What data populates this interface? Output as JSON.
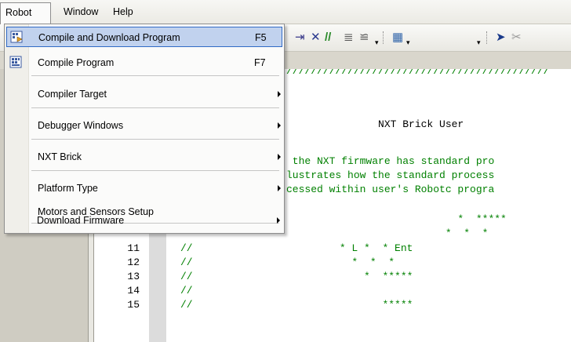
{
  "menubar": {
    "items": [
      "Robot",
      "Window",
      "Help"
    ]
  },
  "robot_menu": {
    "items": [
      {
        "label": "Compile and Download Program",
        "shortcut": "F5",
        "icon": "download-program-icon",
        "highlighted": true
      },
      {
        "label": "Compile Program",
        "shortcut": "F7",
        "icon": "compile-program-icon"
      },
      {
        "label": "Compiler Target",
        "submenu": true
      },
      {
        "label": "Debugger Windows",
        "submenu": true
      },
      {
        "label": "NXT Brick",
        "submenu": true
      },
      {
        "label": "Platform Type",
        "submenu": true
      },
      {
        "label": "Motors and Sensors Setup"
      },
      {
        "label": "Download Firmware",
        "submenu": true
      }
    ]
  },
  "editor": {
    "visible_lines": [
      {
        "num": "",
        "text": "///////////////////////////////////////////",
        "color": "#008000"
      },
      {
        "num": "",
        "text": "",
        "color": "#008000"
      },
      {
        "num": "",
        "text": "               NXT Brick User",
        "color": "#000000"
      },
      {
        "num": "",
        "text": "",
        "color": "#008000"
      },
      {
        "num": "",
        "text": " the NXT firmware has standard pro",
        "color": "#008000"
      },
      {
        "num": "",
        "text": "lustrates how the standard process",
        "color": "#008000"
      },
      {
        "num": "",
        "text": "cessed within user's Robotc progra",
        "color": "#008000"
      },
      {
        "num": "",
        "text": "",
        "color": "#008000"
      },
      {
        "num": "",
        "text": "                            *  *****",
        "color": "#008000"
      },
      {
        "num": "",
        "text": "                          *  *  *",
        "color": "#008000"
      },
      {
        "num": "11",
        "text": "//                        * L *  * Ent",
        "color": "#008000"
      },
      {
        "num": "12",
        "text": "//                          *  *  *",
        "color": "#008000"
      },
      {
        "num": "13",
        "text": "//                            *  *****",
        "color": "#008000"
      },
      {
        "num": "14",
        "text": "//",
        "color": "#008000"
      },
      {
        "num": "15",
        "text": "//                               *****",
        "color": "#008000"
      }
    ]
  },
  "colors": {
    "menu_highlight": "#c1d2ee",
    "menu_highlight_border": "#316ac5",
    "comment": "#008000"
  }
}
